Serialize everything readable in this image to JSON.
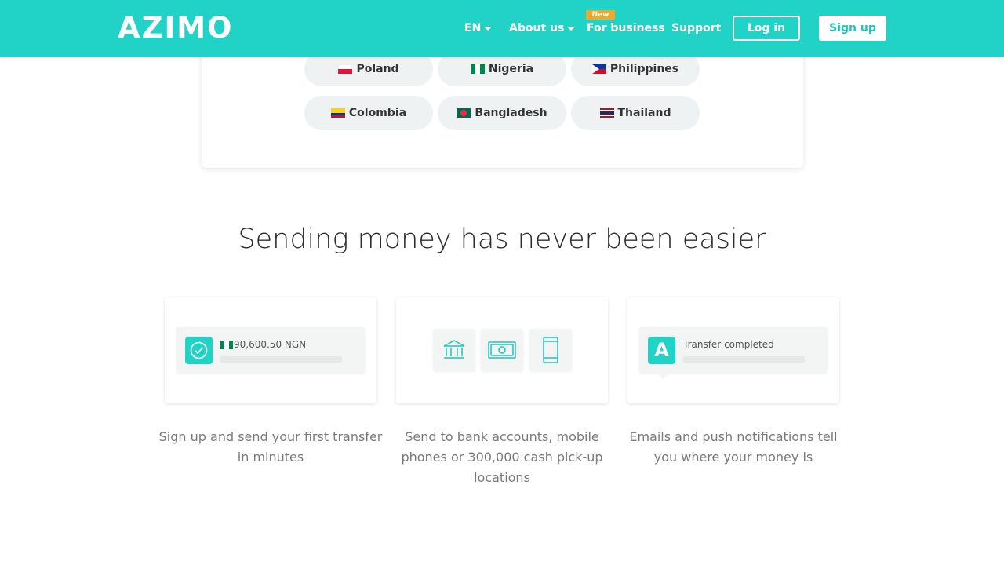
{
  "header": {
    "logo": "AZIMO",
    "lang": "EN",
    "about": "About us",
    "new_badge": "New",
    "business": "For business",
    "support": "Support",
    "login": "Log in",
    "signup": "Sign up",
    "brand_color": "#21d3c6"
  },
  "countries": [
    {
      "name": "Poland",
      "flag": "poland-flag-icon"
    },
    {
      "name": "Nigeria",
      "flag": "nigeria-flag-icon"
    },
    {
      "name": "Philippines",
      "flag": "philippines-flag-icon"
    },
    {
      "name": "Colombia",
      "flag": "colombia-flag-icon"
    },
    {
      "name": "Bangladesh",
      "flag": "bangladesh-flag-icon"
    },
    {
      "name": "Thailand",
      "flag": "thailand-flag-icon"
    }
  ],
  "section": {
    "title": "Sending money has never been easier",
    "features": [
      {
        "amount": "90,600.50 NGN",
        "description": "Sign up and send your first transfer in minutes"
      },
      {
        "icons": [
          "bank-icon",
          "cash-icon",
          "phone-icon"
        ],
        "description": "Send to bank accounts, mobile phones or 300,000 cash pick-up locations"
      },
      {
        "badge_letter": "A",
        "status": "Transfer completed",
        "description": "Emails and push notifications tell you where your money is"
      }
    ]
  }
}
